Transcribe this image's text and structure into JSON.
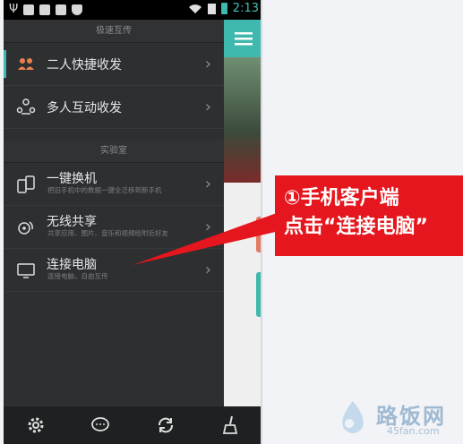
{
  "status_bar": {
    "time": "2:13",
    "icons": [
      "usb-icon",
      "app-icon",
      "image-icon",
      "photo-icon",
      "shield-icon",
      "wifi-icon",
      "sim-icon",
      "battery-icon"
    ]
  },
  "drawer": {
    "section_fast": "极速互传",
    "item_two_person": "二人快捷收发",
    "item_multi_person": "多人互动收发",
    "section_lab": "实验室",
    "item_switch_phone": "一键换机",
    "item_switch_phone_sub": "把旧手机中的数据一键全迁移到新手机",
    "item_wireless_share": "无线共享",
    "item_wireless_share_sub": "共享应用、图片、音乐和视频给附近好友",
    "item_connect_pc": "连接电脑",
    "item_connect_pc_sub": "连接电脑，自由互传"
  },
  "bottom_bar": {
    "icons": [
      "settings-icon",
      "chat-icon",
      "refresh-icon",
      "broom-icon"
    ]
  },
  "callout": {
    "line1": "①手机客户端",
    "line2": "点击“连接电脑”"
  },
  "watermark": {
    "title": "路饭网",
    "site": "45fan.com"
  },
  "colors": {
    "accent": "#3fb8ae",
    "callout_red": "#e5161d",
    "drawer_bg": "#2d2f31"
  }
}
